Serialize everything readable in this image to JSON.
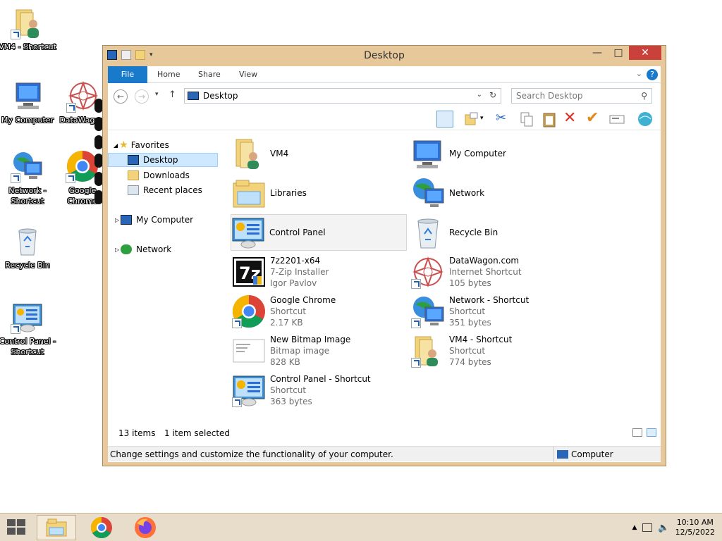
{
  "desktop": {
    "icons": [
      {
        "label": "VM4 - Shortcut",
        "icon": "folder-user-icon"
      },
      {
        "label": "My Computer",
        "icon": "computer-icon"
      },
      {
        "label": "DataWagon.",
        "icon": "datawagon-icon"
      },
      {
        "label": "Network - Shortcut",
        "icon": "network-icon"
      },
      {
        "label": "Google Chrome",
        "icon": "chrome-icon"
      },
      {
        "label": "Recycle Bin",
        "icon": "recycle-bin-icon"
      },
      {
        "label": "Control Panel - Shortcut",
        "icon": "control-panel-icon"
      }
    ]
  },
  "window": {
    "title": "Desktop",
    "close_symbol": "✕",
    "ribbon": {
      "file": "File",
      "home": "Home",
      "share": "Share",
      "view": "View",
      "help": "?"
    },
    "address": {
      "current": "Desktop",
      "search_placeholder": "Search Desktop"
    },
    "nav": {
      "favorites": "Favorites",
      "desktop": "Desktop",
      "downloads": "Downloads",
      "recent": "Recent places",
      "my_computer": "My Computer",
      "network": "Network"
    },
    "items": [
      {
        "name": "VM4",
        "line2": "",
        "line3": "",
        "icon": "folder-user-icon"
      },
      {
        "name": "My Computer",
        "line2": "",
        "line3": "",
        "icon": "computer-icon"
      },
      {
        "name": "Libraries",
        "line2": "",
        "line3": "",
        "icon": "libraries-icon"
      },
      {
        "name": "Network",
        "line2": "",
        "line3": "",
        "icon": "network-icon"
      },
      {
        "name": "Control Panel",
        "line2": "",
        "line3": "",
        "icon": "control-panel-icon"
      },
      {
        "name": "Recycle Bin",
        "line2": "",
        "line3": "",
        "icon": "recycle-bin-icon"
      },
      {
        "name": "7z2201-x64",
        "line2": "7-Zip Installer",
        "line3": "Igor Pavlov",
        "icon": "7zip-icon"
      },
      {
        "name": "DataWagon.com",
        "line2": "Internet Shortcut",
        "line3": "105 bytes",
        "icon": "datawagon-icon"
      },
      {
        "name": "Google Chrome",
        "line2": "Shortcut",
        "line3": "2.17 KB",
        "icon": "chrome-icon"
      },
      {
        "name": "Network - Shortcut",
        "line2": "Shortcut",
        "line3": "351 bytes",
        "icon": "network-icon"
      },
      {
        "name": "New Bitmap Image",
        "line2": "Bitmap image",
        "line3": "828 KB",
        "icon": "bitmap-icon"
      },
      {
        "name": "VM4 - Shortcut",
        "line2": "Shortcut",
        "line3": "774 bytes",
        "icon": "folder-user-icon"
      },
      {
        "name": "Control Panel - Shortcut",
        "line2": "Shortcut",
        "line3": "363 bytes",
        "icon": "control-panel-icon"
      }
    ],
    "status": {
      "count": "13 items",
      "selected": "1 item selected"
    },
    "statusbar": {
      "left": "Change settings and customize the functionality of your computer.",
      "right": "Computer"
    }
  },
  "taskbar": {
    "time": "10:10 AM",
    "date": "12/5/2022"
  }
}
